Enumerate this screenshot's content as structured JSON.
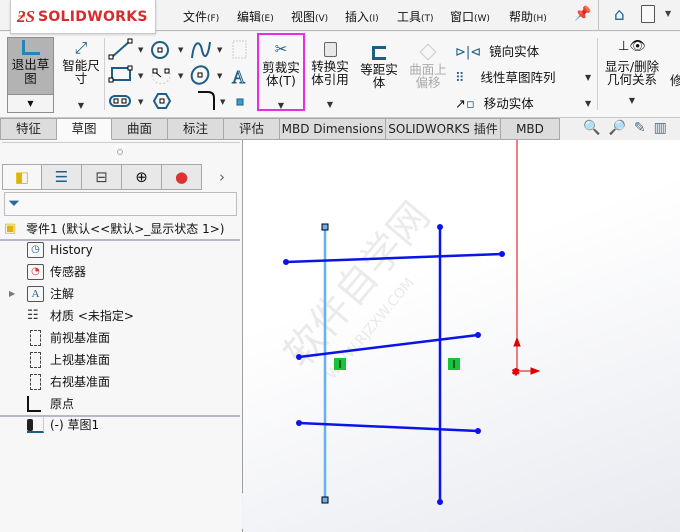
{
  "app": {
    "brand_ds": "ƻS",
    "brand_name": "SOLIDWORKS"
  },
  "menu": [
    {
      "label": "文件",
      "key": "(F)"
    },
    {
      "label": "编辑",
      "key": "(E)"
    },
    {
      "label": "视图",
      "key": "(V)"
    },
    {
      "label": "插入",
      "key": "(I)"
    },
    {
      "label": "工具",
      "key": "(T)"
    },
    {
      "label": "窗口",
      "key": "(W)"
    },
    {
      "label": "帮助",
      "key": "(H)"
    }
  ],
  "ribbon": {
    "exit_sketch": "退出草图",
    "smart_dimension": "智能尺寸",
    "trim_entities": "剪裁实体(T)",
    "convert_entities": "转换实体引用",
    "offset_entities": "等距实体",
    "offset_on_surface": "曲面上偏移",
    "mirror_entities": "镜向实体",
    "linear_pattern": "线性草图阵列",
    "move_entities": "移动实体",
    "display_relations": "显示/删除几何关系",
    "repair": "修"
  },
  "tabs": [
    {
      "label": "特征",
      "active": false
    },
    {
      "label": "草图",
      "active": true
    },
    {
      "label": "曲面",
      "active": false
    },
    {
      "label": "标注",
      "active": false
    },
    {
      "label": "评估",
      "active": false
    },
    {
      "label": "MBD Dimensions",
      "active": false
    },
    {
      "label": "SOLIDWORKS 插件",
      "active": false
    },
    {
      "label": "MBD",
      "active": false
    }
  ],
  "tree": {
    "root": "零件1  (默认<<默认>_显示状态 1>)",
    "items": [
      {
        "label": "History",
        "icon": "history-folder-icon"
      },
      {
        "label": "传感器",
        "icon": "sensor-folder-icon"
      },
      {
        "label": "注解",
        "icon": "annotation-folder-icon",
        "expandable": true
      },
      {
        "label": "材质 <未指定>",
        "icon": "material-icon"
      },
      {
        "label": "前视基准面",
        "icon": "plane-icon"
      },
      {
        "label": "上视基准面",
        "icon": "plane-icon"
      },
      {
        "label": "右视基准面",
        "icon": "plane-icon"
      },
      {
        "label": "原点",
        "icon": "origin-icon"
      },
      {
        "label": "(-) 草图1",
        "icon": "sketch-icon"
      }
    ]
  },
  "sketch": {
    "line_color": "#0a14e6",
    "selected_color": "#66b0f5",
    "relation_badge": "|",
    "watermark": "软件自学网",
    "watermark_url": "WWW.RJZXW.COM"
  },
  "colors": {
    "highlight": "#e52ee5",
    "origin": "#e00000",
    "relation_badge": "#19c23a"
  }
}
